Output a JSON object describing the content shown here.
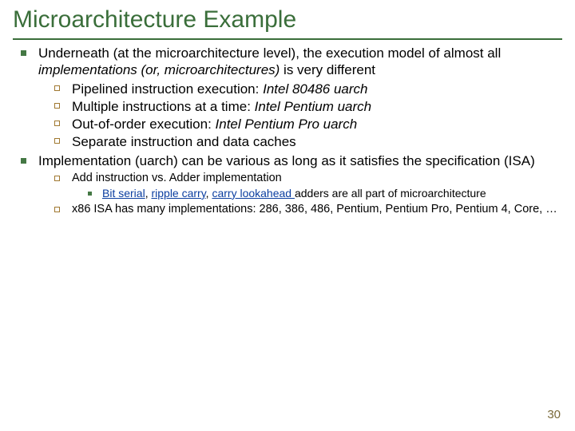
{
  "title": "Microarchitecture Example",
  "bullets": {
    "b1_pre": "Underneath (at the microarchitecture level), the execution model of almost all ",
    "b1_ital": "implementations (or, microarchitectures)",
    "b1_post": " is very different",
    "b1a_pre": "Pipelined instruction execution: ",
    "b1a_ital": "Intel 80486 uarch",
    "b1b_pre": "Multiple instructions at a time: ",
    "b1b_ital": "Intel Pentium uarch",
    "b1c_pre": "Out-of-order execution: ",
    "b1c_ital": "Intel Pentium Pro uarch",
    "b1d": "Separate instruction and data caches",
    "b2": "Implementation (uarch) can be various as long as it satisfies the specification (ISA)",
    "b2a": "Add instruction vs. Adder implementation",
    "b2a1_l1": "Bit serial",
    "b2a1_s1": ", ",
    "b2a1_l2": "ripple carry",
    "b2a1_s2": ", ",
    "b2a1_l3": "carry lookahead ",
    "b2a1_post": "adders are all part of microarchitecture",
    "b2b": "x86 ISA has many implementations: 286, 386, 486, Pentium, Pentium Pro, Pentium 4, Core, …"
  },
  "pagenum": "30"
}
